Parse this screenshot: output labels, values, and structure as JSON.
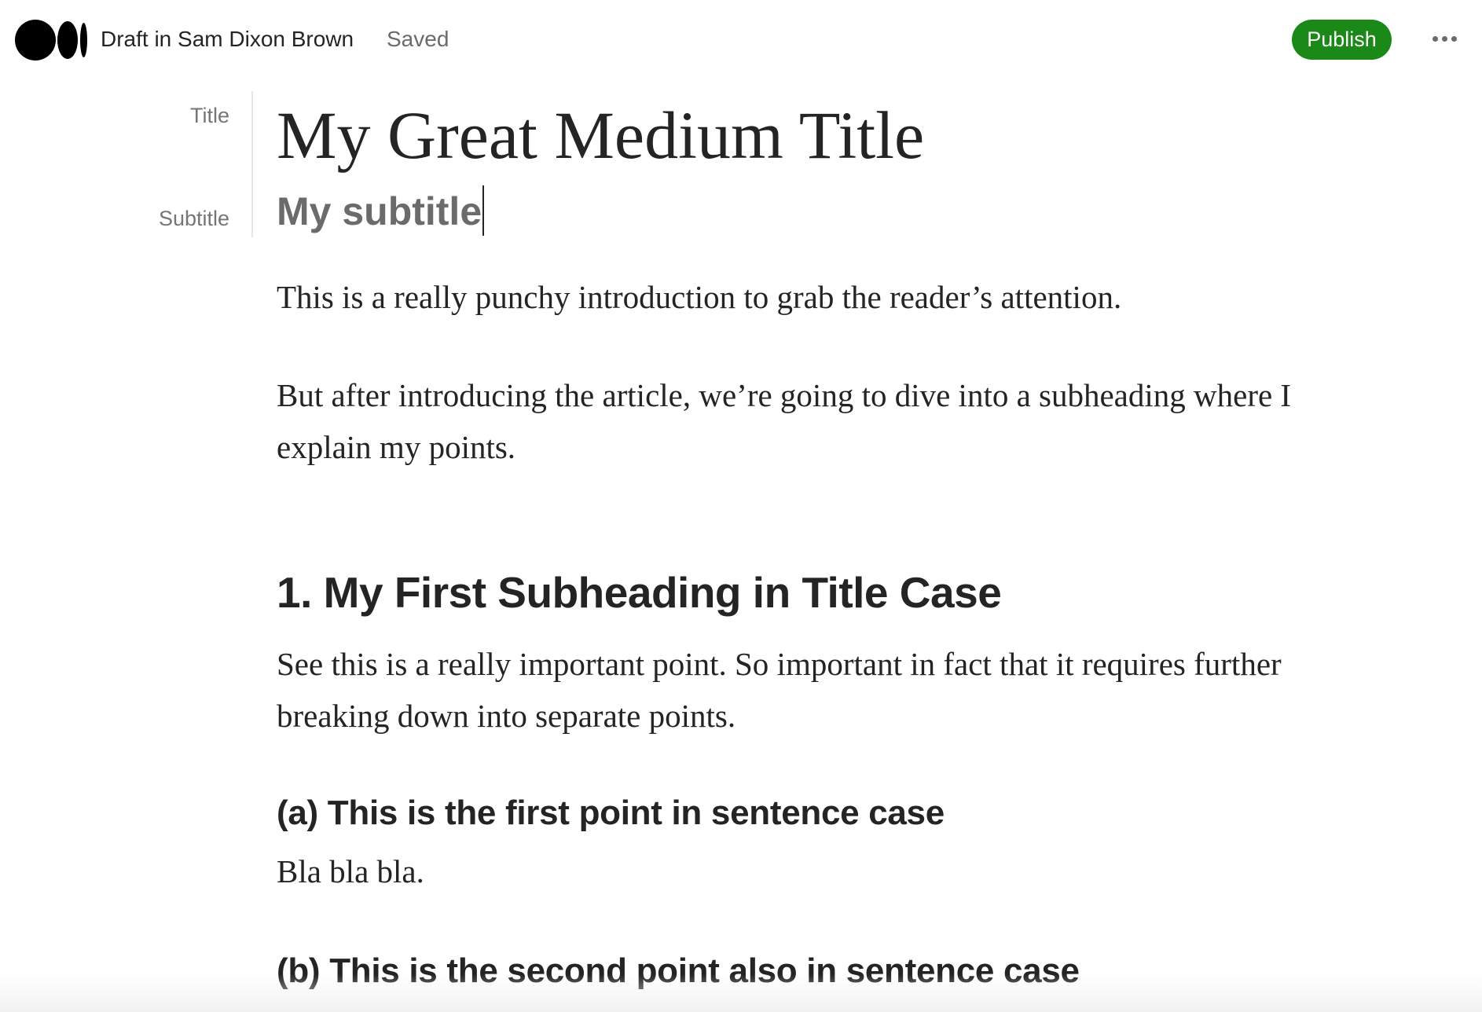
{
  "topbar": {
    "draft_label": "Draft in Sam Dixon Brown",
    "status": "Saved",
    "publish_label": "Publish",
    "more_icon": "more-horizontal-icon",
    "logo_icon": "medium-logo-icon",
    "publish_color": "#1a8917"
  },
  "hints": {
    "title": "Title",
    "subtitle": "Subtitle"
  },
  "article": {
    "title": "My Great Medium Title",
    "subtitle": "My subtitle",
    "intro": "This is a really punchy introduction to grab the reader’s attention.",
    "lead": "But after introducing the article, we’re going to dive into a subheading where I explain my points.",
    "heading_1": "1. My First Subheading in Title Case",
    "heading_1_body": "See this is a really important point. So important in fact that it requires further breaking down into separate points.",
    "point_a_heading": "(a) This is the first point in sentence case",
    "point_a_body": "Bla bla bla.",
    "point_b_heading": "(b) This is the second point also in sentence case"
  }
}
